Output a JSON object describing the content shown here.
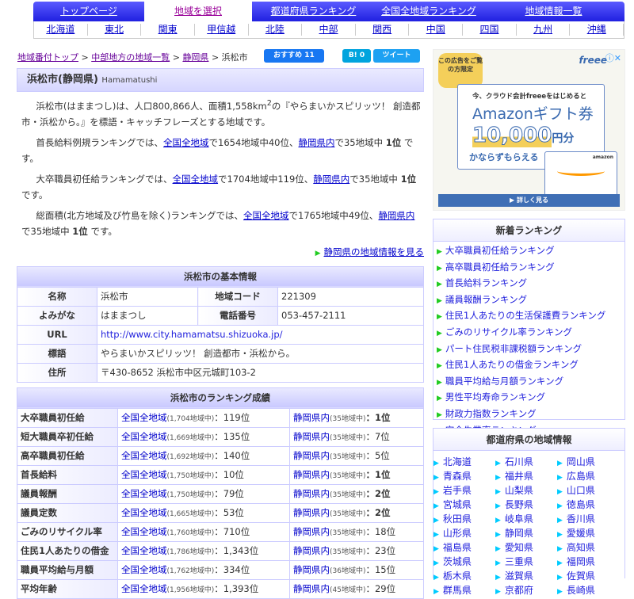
{
  "nav": {
    "top": [
      "トップページ",
      "地域を選択",
      "都道府県ランキング",
      "全国全地域ランキング",
      "地域情報一覧"
    ],
    "active": 1,
    "regions": [
      "北海道",
      "東北",
      "関東",
      "甲信越",
      "北陸",
      "中部",
      "関西",
      "中国",
      "四国",
      "九州",
      "沖縄"
    ]
  },
  "breadcrumb": {
    "items": [
      "地域番付トップ",
      "中部地方の地域一覧",
      "静岡県"
    ],
    "current": "浜松市",
    "sep": ">"
  },
  "share": {
    "fb": "おすすめ 11",
    "hatena": "B! 0",
    "tweet": "ツイート"
  },
  "title": {
    "main": "浜松市(静岡県)",
    "romaji": "Hamamatushi"
  },
  "intro": {
    "text1": "浜松市(はままつし)は、人口800,866人、面積1,558km",
    "sup": "2",
    "text2": "の『やらまいかスピリッツ！ 創造都市・浜松から。』を標語・キャッチフレーズとする地域です。"
  },
  "rank_paras": [
    {
      "pre": "首長給料例規ランキングでは、",
      "l1": "全国全地域",
      "mid": "で1654地域中40位、",
      "l2": "静岡県内",
      "post": "で35地域中 ",
      "bold": "1位",
      "end": " です。"
    },
    {
      "pre": "大卒職員初任給ランキングでは、",
      "l1": "全国全地域",
      "mid": "で1704地域中119位、",
      "l2": "静岡県内",
      "post": "で35地域中 ",
      "bold": "1位",
      "end": " です。"
    },
    {
      "pre": "総面積(北方地域及び竹島を除く)ランキングでは、",
      "l1": "全国全地域",
      "mid": "で1765地域中49位、",
      "l2": "静岡県内",
      "post": "で35地域中 ",
      "bold": "1位",
      "end": " です。"
    }
  ],
  "more_link": "静岡県の地域情報を見る",
  "basic": {
    "title": "浜松市の基本情報",
    "name_l": "名称",
    "name": "浜松市",
    "code_l": "地域コード",
    "code": "221309",
    "kana_l": "よみがな",
    "kana": "はままつし",
    "tel_l": "電話番号",
    "tel": "053-457-2111",
    "url_l": "URL",
    "url": "http://www.city.hamamatsu.shizuoka.jp/",
    "motto_l": "標語",
    "motto": "やらまいかスピリッツ！ 創造都市・浜松から。",
    "addr_l": "住所",
    "addr": "〒430-8652 浜松市中区元城町103-2"
  },
  "ranking": {
    "title": "浜松市のランキング成績",
    "nat_link": "全国全地域",
    "pref_link": "静岡県内",
    "rows": [
      {
        "label": "大卒職員初任給",
        "nat_n": "(1,704地域中)",
        "nat": "：119位",
        "pref_n": "(35地域中)",
        "pref": "：1位",
        "bold": true
      },
      {
        "label": "短大職員卒初任給",
        "nat_n": "(1,669地域中)",
        "nat": "：135位",
        "pref_n": "(35地域中)",
        "pref": "：7位",
        "bold": false
      },
      {
        "label": "高卒職員初任給",
        "nat_n": "(1,692地域中)",
        "nat": "：140位",
        "pref_n": "(35地域中)",
        "pref": "：5位",
        "bold": false
      },
      {
        "label": "首長給料",
        "nat_n": "(1,750地域中)",
        "nat": "：10位",
        "pref_n": "(35地域中)",
        "pref": "：1位",
        "bold": true
      },
      {
        "label": "議員報酬",
        "nat_n": "(1,750地域中)",
        "nat": "：79位",
        "pref_n": "(35地域中)",
        "pref": "：2位",
        "bold": true
      },
      {
        "label": "議員定数",
        "nat_n": "(1,665地域中)",
        "nat": "：53位",
        "pref_n": "(35地域中)",
        "pref": "：2位",
        "bold": true
      },
      {
        "label": "ごみのリサイクル率",
        "nat_n": "(1,760地域中)",
        "nat": "：710位",
        "pref_n": "(35地域中)",
        "pref": "：18位",
        "bold": false
      },
      {
        "label": "住民1人あたりの借金",
        "nat_n": "(1,786地域中)",
        "nat": "：1,343位",
        "pref_n": "(35地域中)",
        "pref": "：23位",
        "bold": false
      },
      {
        "label": "職員平均給与月額",
        "nat_n": "(1,762地域中)",
        "nat": "：334位",
        "pref_n": "(36地域中)",
        "pref": "：15位",
        "bold": false
      },
      {
        "label": "平均年齢",
        "nat_n": "(1,956地域中)",
        "nat": "：1,393位",
        "pref_n": "(45地域中)",
        "pref": "：29位",
        "bold": false
      }
    ]
  },
  "ad": {
    "badge": "この広告をご覧の方限定",
    "line1": "今、クラウド会計freeeをはじめると",
    "line2": "Amazonギフト券",
    "amount": "10,000",
    "unit": "円分",
    "line3": "かならずもらえる",
    "card": "amazon",
    "cta": "詳しく見る",
    "logo": "freee"
  },
  "new_rankings": {
    "title": "新着ランキング",
    "items": [
      "大卒職員初任給ランキング",
      "高卒職員初任給ランキング",
      "首長給料ランキング",
      "議員報酬ランキング",
      "住民1人あたりの生活保護費ランキング",
      "ごみのリサイクル率ランキング",
      "パート住民税非課税額ランキング",
      "住民1人あたりの借金ランキング",
      "職員平均給与月額ランキング",
      "男性平均寿命ランキング",
      "財政力指数ランキング",
      "完全失業率ランキング"
    ]
  },
  "prefectures": {
    "title": "都道府県の地域情報",
    "items": [
      "北海道",
      "石川県",
      "岡山県",
      "青森県",
      "福井県",
      "広島県",
      "岩手県",
      "山梨県",
      "山口県",
      "宮城県",
      "長野県",
      "徳島県",
      "秋田県",
      "岐阜県",
      "香川県",
      "山形県",
      "静岡県",
      "愛媛県",
      "福島県",
      "愛知県",
      "高知県",
      "茨城県",
      "三重県",
      "福岡県",
      "栃木県",
      "滋賀県",
      "佐賀県",
      "群馬県",
      "京都府",
      "長崎県"
    ]
  },
  "colors": {
    "nav": "#2a2af0",
    "link": "#0000cc",
    "accent_green": "#22cc22",
    "header_bg": "#d6d6ff"
  }
}
